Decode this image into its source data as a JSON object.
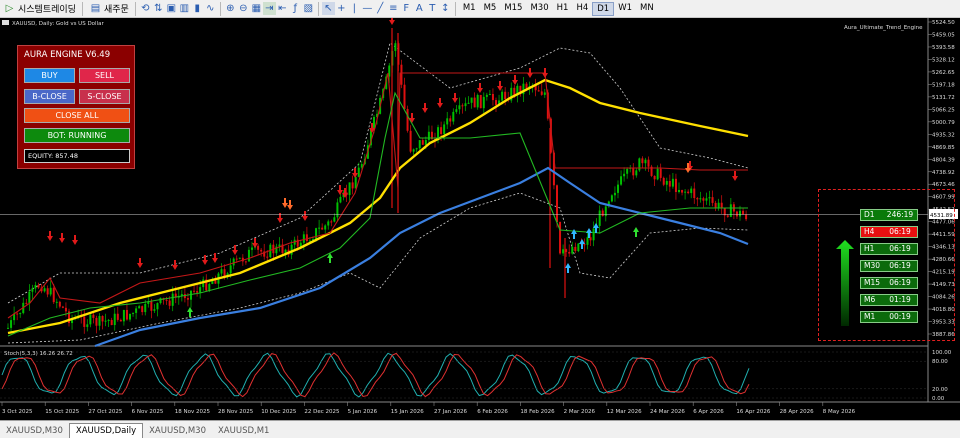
{
  "toolbar": {
    "auto_trading_label": "시스템트레이딩",
    "new_order_label": "새주문",
    "timeframes": [
      "M1",
      "M5",
      "M15",
      "M30",
      "H1",
      "H4",
      "D1",
      "W1",
      "MN"
    ],
    "active_timeframe": "D1"
  },
  "chart": {
    "symbol_label": "XAUUSD, Daily: Gold vs US Dollar",
    "indicator_label": "Aura_Ultimate_Trend_Engine",
    "current_price": "4531.89",
    "price_ticks": [
      "5524.50",
      "5459.05",
      "5393.58",
      "5328.12",
      "5262.65",
      "5197.18",
      "5131.72",
      "5066.25",
      "5000.79",
      "4935.32",
      "4869.85",
      "4804.39",
      "4738.92",
      "4673.46",
      "4607.99",
      "4542.52",
      "4477.06",
      "4411.59",
      "4346.13",
      "4280.66",
      "4215.19",
      "4149.73",
      "4084.26",
      "4018.80",
      "3953.33",
      "3887.86"
    ],
    "date_ticks": [
      "3 Oct 2025",
      "15 Oct 2025",
      "27 Oct 2025",
      "6 Nov 2025",
      "18 Nov 2025",
      "28 Nov 2025",
      "10 Dec 2025",
      "22 Dec 2025",
      "5 Jan 2026",
      "15 Jan 2026",
      "27 Jan 2026",
      "6 Feb 2026",
      "18 Feb 2026",
      "2 Mar 2026",
      "12 Mar 2026",
      "24 Mar 2026",
      "6 Apr 2026",
      "16 Apr 2026",
      "28 Apr 2026",
      "8 May 2026"
    ],
    "colors": {
      "up": "#00c000",
      "down": "#e01010",
      "yellow_ma": "#ffe000",
      "blue_ma": "#3a7fe0"
    }
  },
  "stoch": {
    "label": "Stoch(5,3,3) 16.26 26.72",
    "ticks": [
      "100.00",
      "80.00",
      "20.00",
      "0.00"
    ],
    "colors": {
      "main": "#20b0b0",
      "signal": "#e03030"
    }
  },
  "panel": {
    "title": "AURA ENGINE V6.49",
    "buy": "BUY",
    "sell": "SELL",
    "bclose": "B-CLOSE",
    "sclose": "S-CLOSE",
    "closeall": "CLOSE ALL",
    "bot": "BOT: RUNNING",
    "equity": "EQUITY: 857.48"
  },
  "mtf": [
    {
      "tf": "D1",
      "val": "246:19",
      "trend": "up"
    },
    {
      "tf": "H4",
      "val": "06:19",
      "trend": "down"
    },
    {
      "tf": "H1",
      "val": "06:19",
      "trend": "up"
    },
    {
      "tf": "M30",
      "val": "06:19",
      "trend": "up"
    },
    {
      "tf": "M15",
      "val": "06:19",
      "trend": "up"
    },
    {
      "tf": "M6",
      "val": "01:19",
      "trend": "up"
    },
    {
      "tf": "M1",
      "val": "00:19",
      "trend": "up"
    }
  ],
  "tabs": [
    "XAUUSD,M30",
    "XAUUSD,Daily",
    "XAUUSD,M30",
    "XAUUSD,M1"
  ],
  "active_tab": 1
}
